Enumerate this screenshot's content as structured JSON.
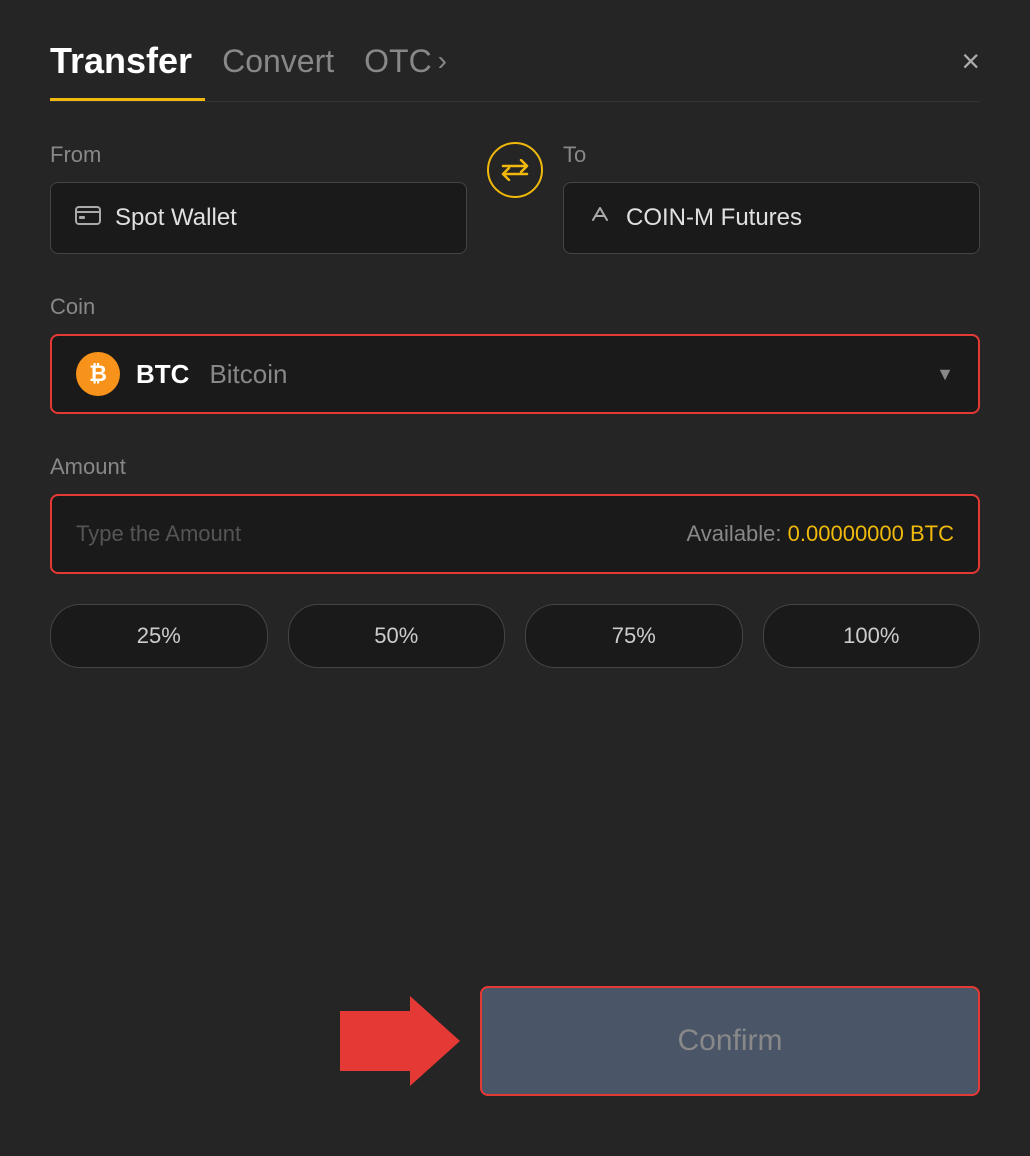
{
  "header": {
    "tab_transfer": "Transfer",
    "tab_convert": "Convert",
    "tab_otc": "OTC",
    "close_label": "×"
  },
  "from": {
    "label": "From",
    "wallet_name": "Spot Wallet"
  },
  "to": {
    "label": "To",
    "wallet_name": "COIN-M Futures"
  },
  "coin": {
    "label": "Coin",
    "symbol": "BTC",
    "name": "Bitcoin"
  },
  "amount": {
    "label": "Amount",
    "placeholder": "Type the Amount",
    "available_label": "Available:",
    "available_value": "0.00000000 BTC"
  },
  "percentages": [
    {
      "label": "25%"
    },
    {
      "label": "50%"
    },
    {
      "label": "75%"
    },
    {
      "label": "100%"
    }
  ],
  "confirm": {
    "label": "Confirm"
  },
  "icons": {
    "card": "▣",
    "transfer": "↑",
    "swap": "⇄",
    "chevron": "›",
    "btc": "₿",
    "dropdown_arrow": "▼"
  },
  "colors": {
    "accent": "#f0b90b",
    "error_border": "#e53935",
    "bg_dark": "#252525",
    "bg_darker": "#1a1a1a"
  }
}
